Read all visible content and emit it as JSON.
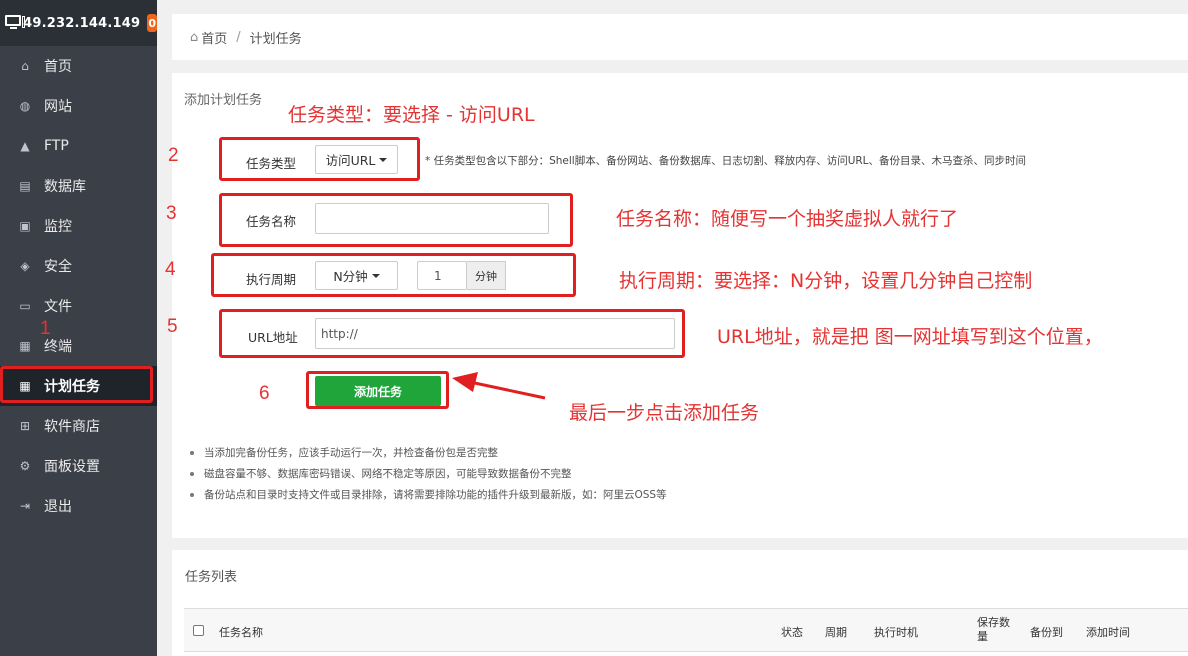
{
  "sidebar": {
    "server_ip": "49.232.144.149",
    "badge_count": "0",
    "items": [
      {
        "label": "首页",
        "icon": "home-icon"
      },
      {
        "label": "网站",
        "icon": "globe-icon"
      },
      {
        "label": "FTP",
        "icon": "ftp-icon"
      },
      {
        "label": "数据库",
        "icon": "database-icon"
      },
      {
        "label": "监控",
        "icon": "monitor-chart-icon"
      },
      {
        "label": "安全",
        "icon": "shield-icon"
      },
      {
        "label": "文件",
        "icon": "folder-icon"
      },
      {
        "label": "终端",
        "icon": "terminal-icon"
      },
      {
        "label": "计划任务",
        "icon": "calendar-icon"
      },
      {
        "label": "软件商店",
        "icon": "grid-icon"
      },
      {
        "label": "面板设置",
        "icon": "gear-icon"
      },
      {
        "label": "退出",
        "icon": "logout-icon"
      }
    ]
  },
  "breadcrumb": {
    "home": "首页",
    "separator": "/",
    "current": "计划任务"
  },
  "form": {
    "title": "添加计划任务",
    "task_type_label": "任务类型",
    "task_type_value": "访问URL",
    "task_type_hint": "* 任务类型包含以下部分：Shell脚本、备份网站、备份数据库、日志切割、释放内存、访问URL、备份目录、木马查杀、同步时间",
    "task_name_label": "任务名称",
    "task_name_value": "",
    "cycle_label": "执行周期",
    "cycle_value": "N分钟",
    "cycle_minutes": "1",
    "cycle_unit": "分钟",
    "url_label": "URL地址",
    "url_value": "http://",
    "submit_label": "添加任务"
  },
  "tips": [
    "当添加完备份任务，应该手动运行一次，并检查备份包是否完整",
    "磁盘容量不够、数据库密码错误、网络不稳定等原因，可能导致数据备份不完整",
    "备份站点和目录时支持文件或目录排除，请将需要排除功能的插件升级到最新版，如：阿里云OSS等"
  ],
  "task_list": {
    "title": "任务列表",
    "columns": [
      "任务名称",
      "状态",
      "周期",
      "执行时机",
      "保存数量",
      "备份到",
      "添加时间"
    ]
  },
  "annotations": {
    "n1": "1",
    "n2": "2",
    "n3": "3",
    "n4": "4",
    "n5": "5",
    "n6": "6",
    "type_note": "任务类型：要选择 -  访问URL",
    "name_note": "任务名称：随便写一个抽奖虚拟人就行了",
    "cycle_note": "执行周期：要选择：N分钟，设置几分钟自己控制",
    "url_note": "URL地址，就是把 图一网址填写到这个位置，",
    "final_note": "最后一步点击添加任务"
  },
  "colors": {
    "sidebar_bg": "#3b3f48",
    "accent_green": "#20a53a",
    "annotation_red": "#e02020",
    "badge_orange": "#f0651e"
  }
}
